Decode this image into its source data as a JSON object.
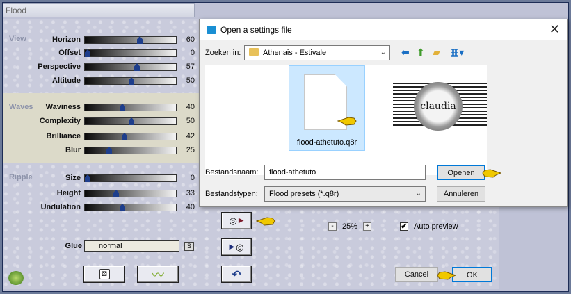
{
  "window": {
    "title": "Flood"
  },
  "sections": {
    "view": "View",
    "waves": "Waves",
    "ripple": "Ripple"
  },
  "params": [
    {
      "label": "Horizon",
      "value": "60",
      "fraction": 0.6
    },
    {
      "label": "Offset",
      "value": "0",
      "fraction": 0.0
    },
    {
      "label": "Perspective",
      "value": "57",
      "fraction": 0.57
    },
    {
      "label": "Altitude",
      "value": "50",
      "fraction": 0.5
    },
    {
      "label": "Waviness",
      "value": "40",
      "fraction": 0.4
    },
    {
      "label": "Complexity",
      "value": "50",
      "fraction": 0.5
    },
    {
      "label": "Brilliance",
      "value": "42",
      "fraction": 0.42
    },
    {
      "label": "Blur",
      "value": "25",
      "fraction": 0.25
    },
    {
      "label": "Size",
      "value": "0",
      "fraction": 0.0
    },
    {
      "label": "Height",
      "value": "33",
      "fraction": 0.33
    },
    {
      "label": "Undulation",
      "value": "40",
      "fraction": 0.4
    }
  ],
  "glue": {
    "label": "Glue",
    "value": "normal",
    "s_label": "S"
  },
  "zoom": {
    "value": "25%",
    "minus": "-",
    "plus": "+"
  },
  "auto_preview": {
    "label": "Auto preview",
    "checked": "✔"
  },
  "buttons": {
    "cancel": "Cancel",
    "ok": "OK"
  },
  "dialog": {
    "title": "Open a settings file",
    "lookin_label": "Zoeken in:",
    "lookin_value": "Athenais - Estivale",
    "filename_label": "Bestandsnaam:",
    "filename_value": "flood-athetuto",
    "filetype_label": "Bestandstypen:",
    "filetype_value": "Flood presets (*.q8r)",
    "open_button": "Openen",
    "cancel_button": "Annuleren",
    "file_item": "flood-athetuto.q8r",
    "thumb_text": "claudia"
  }
}
